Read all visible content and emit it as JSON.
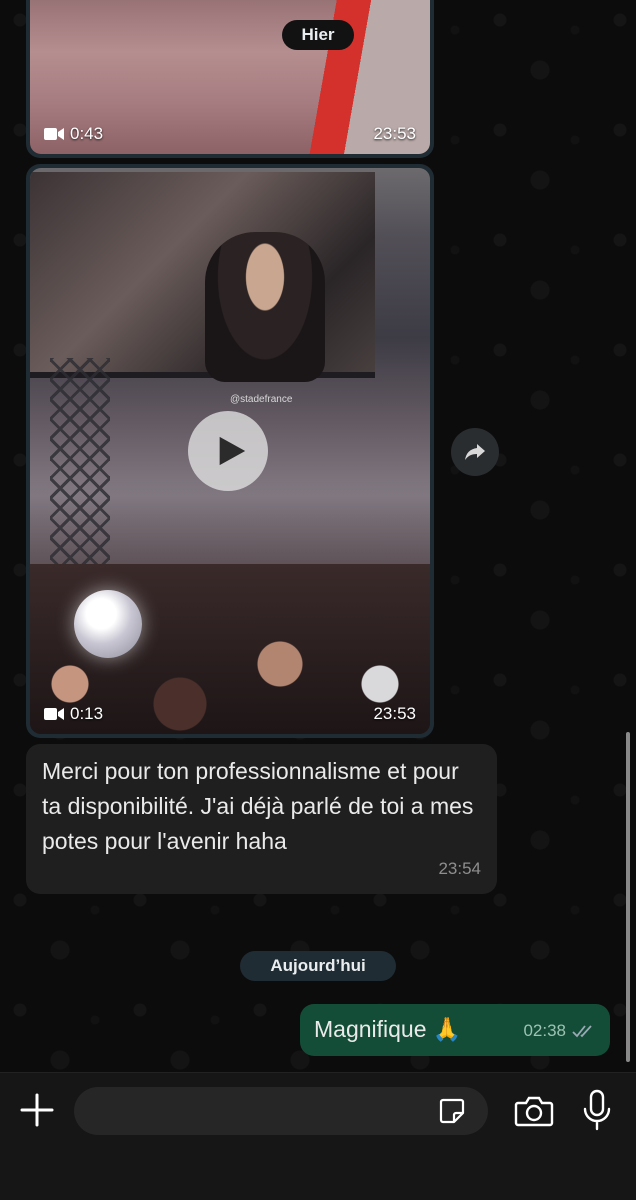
{
  "chat": {
    "date_separators": {
      "yesterday": "Hier",
      "today": "Aujourd’hui"
    },
    "messages": [
      {
        "type": "video",
        "duration": "0:43",
        "time": "23:53"
      },
      {
        "type": "video",
        "duration": "0:13",
        "time": "23:53",
        "overlay_text": "@stadefrance"
      },
      {
        "type": "text",
        "direction": "incoming",
        "text": "Merci pour ton professionnalisme et pour ta disponibilité. J'ai déjà parlé de toi a mes potes pour l'avenir haha",
        "time": "23:54"
      },
      {
        "type": "text",
        "direction": "outgoing",
        "text": "Magnifique 🙏",
        "time": "02:38",
        "status": "read"
      }
    ]
  },
  "composer": {
    "input_value": "",
    "icons": [
      "plus-icon",
      "sticker-icon",
      "camera-icon",
      "microphone-icon"
    ]
  },
  "colors": {
    "incoming_bubble": "#1f1f1f",
    "outgoing_bubble": "#134d37",
    "background": "#0c0c0c"
  }
}
